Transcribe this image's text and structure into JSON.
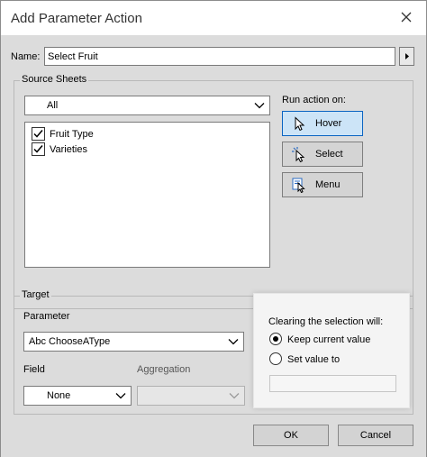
{
  "window": {
    "title": "Add Parameter Action"
  },
  "name_field": {
    "label": "Name:",
    "value": "Select Fruit"
  },
  "source_sheets": {
    "title": "Source Sheets",
    "dropdown_value": "All",
    "sheets": [
      {
        "label": "Fruit Type",
        "checked": true
      },
      {
        "label": "Varieties",
        "checked": true
      }
    ]
  },
  "run_action": {
    "label": "Run action on:",
    "options": [
      {
        "label": "Hover",
        "icon": "cursor-arrow-icon",
        "active": true
      },
      {
        "label": "Select",
        "icon": "cursor-click-icon",
        "active": false
      },
      {
        "label": "Menu",
        "icon": "cursor-menu-icon",
        "active": false
      }
    ]
  },
  "target": {
    "title": "Target",
    "parameter_label": "Parameter",
    "parameter_value": "Abc ChooseAType",
    "field_label": "Field",
    "field_value": "None",
    "aggregation_label": "Aggregation",
    "aggregation_value": ""
  },
  "clearing": {
    "label": "Clearing the selection will:",
    "options": [
      {
        "label": "Keep current value",
        "selected": true
      },
      {
        "label": "Set value to",
        "selected": false
      }
    ],
    "value_input": ""
  },
  "buttons": {
    "ok": "OK",
    "cancel": "Cancel"
  },
  "colors": {
    "accent": "#0a64c2",
    "active_bg": "#cce4f7",
    "panel": "#dcdcdc"
  }
}
